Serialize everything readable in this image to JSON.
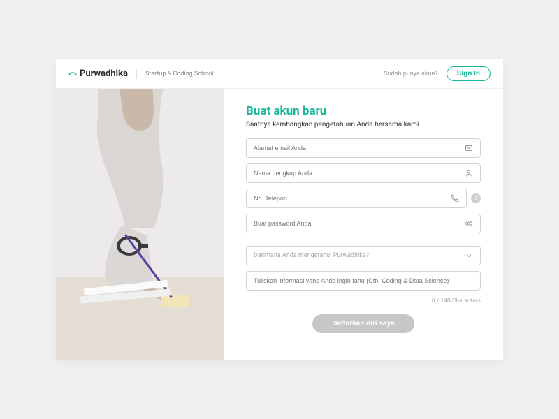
{
  "header": {
    "brand_name": "Purwadhika",
    "brand_tag": "Startup & Coding School",
    "have_account": "Sudah punya akun?",
    "signin": "Sign In"
  },
  "form": {
    "title": "Buat akun baru",
    "subtitle": "Saatnya kembangkan pengetahuan Anda bersama kami",
    "email_placeholder": "Alamat email Anda",
    "name_placeholder": "Nama Lengkap Anda",
    "phone_placeholder": "No. Telepon",
    "password_placeholder": "Buat password Anda",
    "source_placeholder": "Darimana Anda mengetahui Purwadhika?",
    "info_placeholder": "Tuliskan informasi yang Anda ingin tahu (Cth. Coding & Data Science)",
    "char_count": "0 / 140 Characters",
    "submit": "Daftarkan diri saya",
    "help_symbol": "?"
  }
}
